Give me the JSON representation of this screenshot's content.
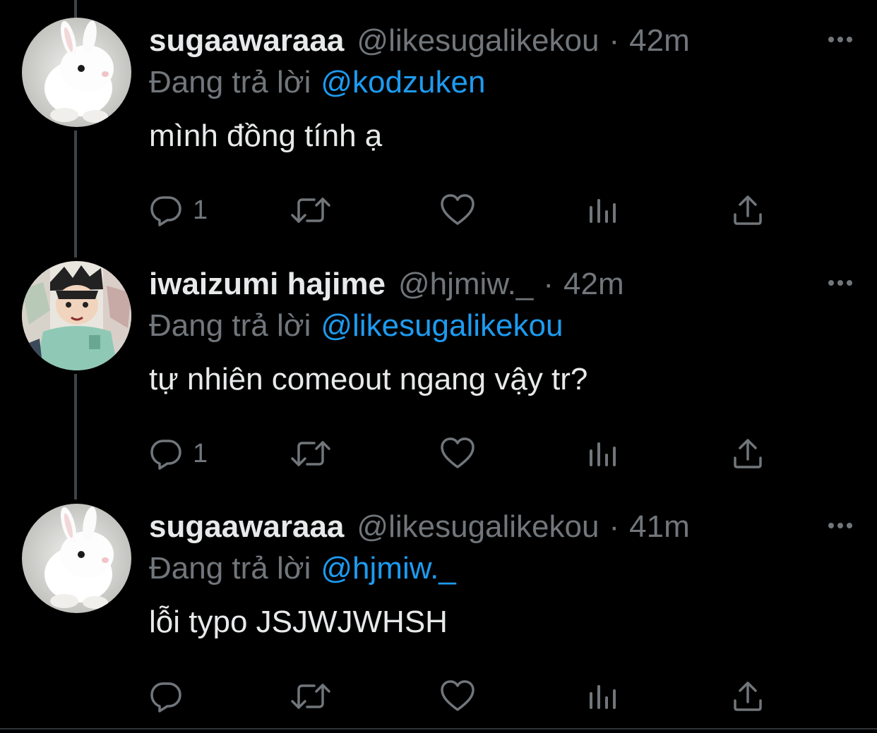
{
  "colors": {
    "background": "#000000",
    "name": "#e7e9ea",
    "muted": "#71767b",
    "mention": "#1d9bf0",
    "thread_line": "#3d4349"
  },
  "tweets": [
    {
      "avatar": "white-bunny-avatar",
      "name": "sugaawaraaa",
      "handle": "@likesugalikekou",
      "separator": "·",
      "time": "42m",
      "reply_prefix": "Đang trả lời",
      "reply_mention": "@kodzuken",
      "text": "mình đồng tính ạ",
      "reply_count": "1"
    },
    {
      "avatar": "anime-character-avatar",
      "name": "iwaizumi hajime",
      "handle": "@hjmiw._",
      "separator": "·",
      "time": "42m",
      "reply_prefix": "Đang trả lời",
      "reply_mention": "@likesugalikekou",
      "text": "tự nhiên comeout ngang vậy tr?",
      "reply_count": "1"
    },
    {
      "avatar": "white-bunny-avatar",
      "name": "sugaawaraaa",
      "handle": "@likesugalikekou",
      "separator": "·",
      "time": "41m",
      "reply_prefix": "Đang trả lời",
      "reply_mention": "@hjmiw._",
      "text": "lỗi typo JSJWJWHSH",
      "reply_count": ""
    }
  ],
  "icons": {
    "reply": "reply-icon",
    "retweet": "retweet-icon",
    "like": "heart-icon",
    "views": "views-icon",
    "share": "share-icon",
    "more": "more-icon"
  }
}
